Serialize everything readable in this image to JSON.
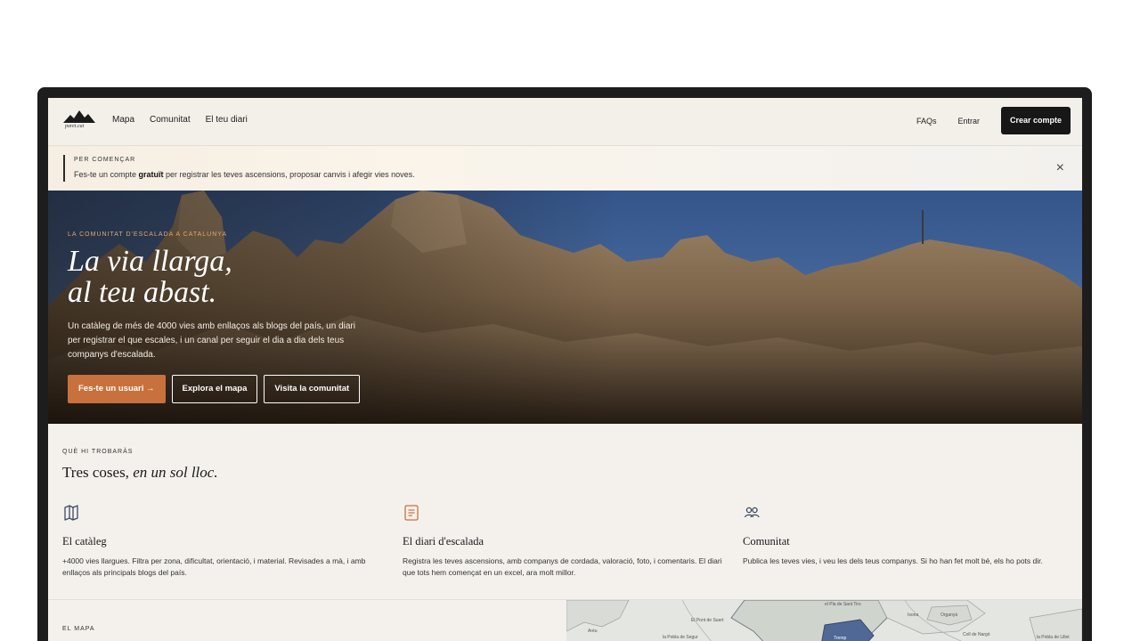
{
  "brand": {
    "name": "paret.cat"
  },
  "nav": {
    "links": [
      "Mapa",
      "Comunitat",
      "El teu diari"
    ],
    "faqs": "FAQs",
    "login": "Entrar",
    "create_account": "Crear compte"
  },
  "banner": {
    "title": "PER COMENÇAR",
    "text_before": "Fes-te un compte ",
    "text_bold": "gratuït",
    "text_after": " per registrar les teves ascensions, proposar canvis i afegir vies noves.",
    "close": "×"
  },
  "hero": {
    "kicker": "LA COMUNITAT D'ESCALADA A CATALUNYA",
    "title_line1": "La via llarga,",
    "title_line2": "al teu abast.",
    "description": "Un catàleg de més de 4000 vies amb enllaços als blogs del país, un diari per registrar el que escales, i un canal per seguir el dia a dia dels teus companys d'escalada.",
    "buttons": [
      "Fes-te un usuari →",
      "Explora el mapa",
      "Visita la comunitat"
    ]
  },
  "features": {
    "kicker": "QUÈ HI TROBARÀS",
    "title_plain": "Tres coses, ",
    "title_italic": "en un sol lloc.",
    "items": [
      {
        "icon": "map-icon",
        "title": "El catàleg",
        "desc": "+4000 vies llargues. Filtra per zona, dificultat, orientació, i material. Revisades a mà, i amb enllaços als principals blogs del país."
      },
      {
        "icon": "journal-icon",
        "title": "El diari d'escalada",
        "desc": "Registra les teves ascensions, amb companys de cordada, valoració, foto, i comentaris. El diari que tots hem començat en un excel, ara molt millor."
      },
      {
        "icon": "users-icon",
        "title": "Comunitat",
        "desc": "Publica les teves vies, i veu les dels teus companys. Si ho han fet molt bé, els ho pots dir."
      }
    ]
  },
  "map_section": {
    "kicker": "EL MAPA",
    "place_labels": [
      "el Pla de Sant Tirs",
      "la Pobla de Segur",
      "Aréu",
      "Tremp",
      "Isona",
      "El Pont de Suert",
      "Organyà",
      "Coll de Nargó",
      "la Pobla de Lillet"
    ]
  },
  "colors": {
    "accent": "#c8713d",
    "dark": "#171717",
    "background": "#f4f1ec",
    "sky": "#3d5f93"
  }
}
